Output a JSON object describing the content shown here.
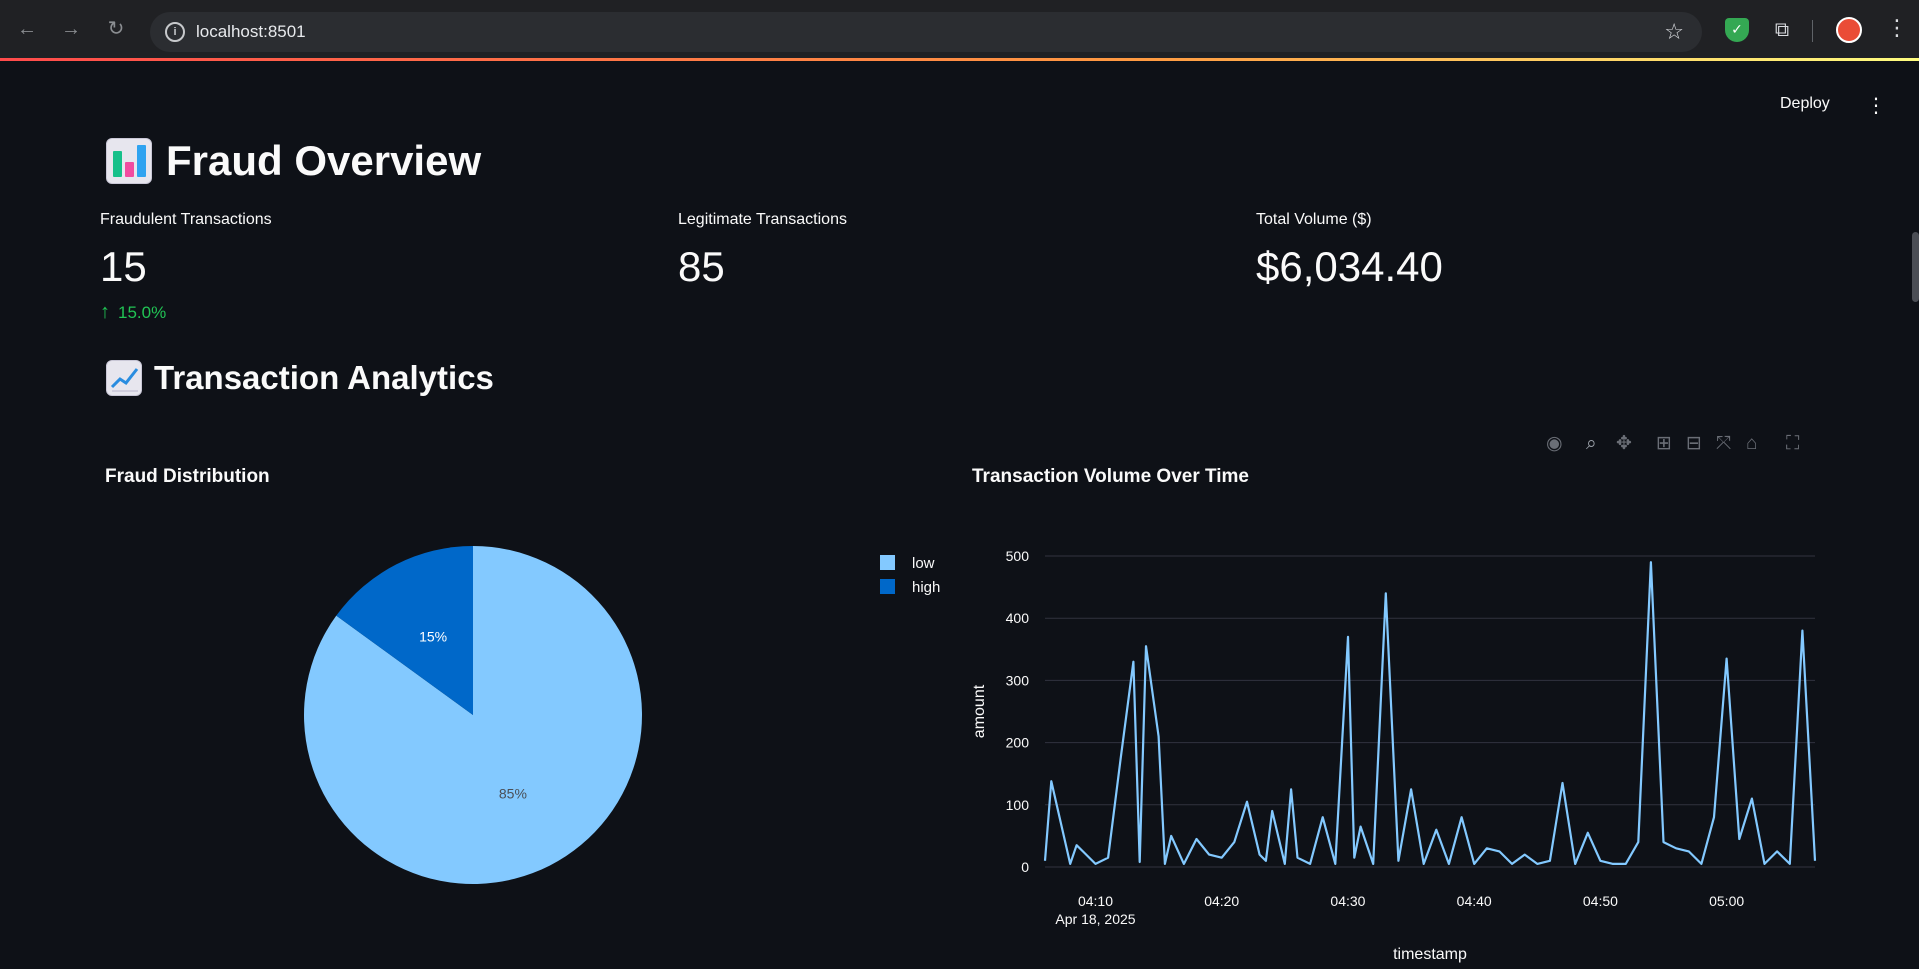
{
  "browser": {
    "url": "localhost:8501"
  },
  "app": {
    "deploy_label": "Deploy"
  },
  "header": {
    "title": "Fraud Overview"
  },
  "metrics": [
    {
      "label": "Fraudulent Transactions",
      "value": "15",
      "delta": "15.0%",
      "delta_color": "#21c354"
    },
    {
      "label": "Legitimate Transactions",
      "value": "85"
    },
    {
      "label": "Total Volume ($)",
      "value": "$6,034.40"
    }
  ],
  "analytics": {
    "title": "Transaction Analytics"
  },
  "chart_data": [
    {
      "type": "pie",
      "title": "Fraud Distribution",
      "labels": [
        "low",
        "high"
      ],
      "values": [
        85,
        15
      ],
      "value_labels": [
        "85%",
        "15%"
      ],
      "colors": [
        "#83c9ff",
        "#0068c9"
      ],
      "legend": "top-right"
    },
    {
      "type": "line",
      "title": "Transaction Volume Over Time",
      "xlabel": "timestamp",
      "ylabel": "amount",
      "x_tick_labels": [
        "04:10",
        "04:20",
        "04:30",
        "04:40",
        "04:50",
        "05:00"
      ],
      "x_tick_sublabel": "Apr 18, 2025",
      "y_ticks": [
        0,
        100,
        200,
        300,
        400,
        500
      ],
      "ylim": [
        0,
        500
      ],
      "color": "#83c9ff",
      "grid": true,
      "series": [
        {
          "x": [
            "04:06",
            "04:06:30",
            "04:08",
            "04:08:30",
            "04:09",
            "04:10",
            "04:11",
            "04:12",
            "04:13",
            "04:13:30",
            "04:14",
            "04:15",
            "04:15:30",
            "04:16",
            "04:17",
            "04:18",
            "04:19",
            "04:20",
            "04:21",
            "04:22",
            "04:23",
            "04:23:30",
            "04:24",
            "04:25",
            "04:25:30",
            "04:26",
            "04:27",
            "04:28",
            "04:29",
            "04:30",
            "04:30:30",
            "04:31",
            "04:32",
            "04:33",
            "04:34",
            "04:35",
            "04:36",
            "04:37",
            "04:38",
            "04:39",
            "04:40",
            "04:41",
            "04:42",
            "04:43",
            "04:44",
            "04:45",
            "04:46",
            "04:47",
            "04:48",
            "04:49",
            "04:50",
            "04:51",
            "04:52",
            "04:53",
            "04:54",
            "04:55",
            "04:56",
            "04:57",
            "04:58",
            "04:59",
            "05:00",
            "05:01",
            "05:02",
            "05:03",
            "05:04",
            "05:05",
            "05:06",
            "05:07"
          ],
          "y": [
            10,
            138,
            5,
            35,
            25,
            5,
            15,
            175,
            330,
            8,
            355,
            210,
            5,
            50,
            5,
            45,
            20,
            15,
            40,
            105,
            20,
            10,
            90,
            5,
            125,
            15,
            5,
            80,
            5,
            370,
            15,
            65,
            5,
            440,
            10,
            125,
            5,
            60,
            5,
            80,
            5,
            30,
            25,
            5,
            20,
            5,
            10,
            135,
            5,
            55,
            10,
            5,
            5,
            40,
            490,
            40,
            30,
            25,
            5,
            80,
            335,
            45,
            110,
            5,
            25,
            5,
            380,
            10
          ]
        }
      ]
    }
  ],
  "modebar": {
    "icons": [
      "camera-icon",
      "zoom-icon",
      "pan-icon",
      "zoom-in-icon",
      "zoom-out-icon",
      "autoscale-icon",
      "reset-axes-icon",
      "fullscreen-icon"
    ]
  }
}
